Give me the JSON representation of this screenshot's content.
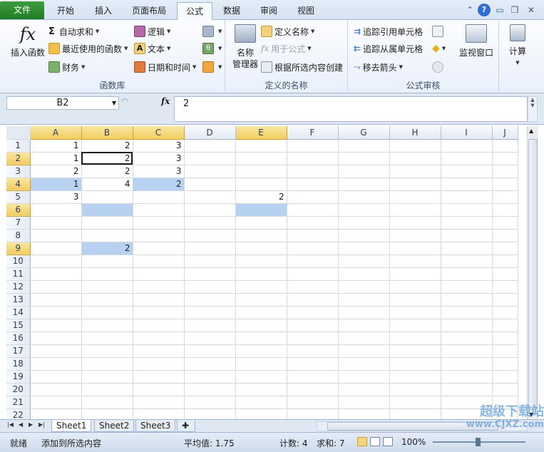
{
  "tabs": [
    "文件",
    "开始",
    "插入",
    "页面布局",
    "公式",
    "数据",
    "审阅",
    "视图"
  ],
  "active_tab": "公式",
  "ribbon": {
    "function_library": {
      "label": "函数库",
      "insert_function": "插入函数",
      "autosum": "自动求和",
      "recent": "最近使用的函数",
      "financial": "财务",
      "logical": "逻辑",
      "text": "文本",
      "datetime": "日期和时间"
    },
    "defined_names": {
      "label": "定义的名称",
      "name_manager_1": "名称",
      "name_manager_2": "管理器",
      "define_name": "定义名称",
      "use_in_formula": "用于公式",
      "create_from_selection": "根据所选内容创建"
    },
    "formula_auditing": {
      "label": "公式审核",
      "trace_precedents": "追踪引用单元格",
      "trace_dependents": "追踪从属单元格",
      "remove_arrows": "移去箭头",
      "watch_window": "监视窗口"
    },
    "calculation": {
      "label": "计算"
    }
  },
  "formula_bar": {
    "name_box": "B2",
    "fx": "fx",
    "value": "2"
  },
  "grid": {
    "columns": [
      "A",
      "B",
      "C",
      "D",
      "E",
      "F",
      "G",
      "H",
      "I",
      "J"
    ],
    "rows": [
      "1",
      "2",
      "3",
      "4",
      "5",
      "6",
      "7",
      "8",
      "9",
      "10",
      "11",
      "12",
      "13",
      "14",
      "15",
      "16",
      "17",
      "18",
      "19",
      "20",
      "21",
      "22"
    ],
    "cells": [
      [
        "1",
        "2",
        "3",
        "",
        "",
        "",
        "",
        "",
        "",
        ""
      ],
      [
        "1",
        "2",
        "3",
        "",
        "",
        "",
        "",
        "",
        "",
        ""
      ],
      [
        "2",
        "2",
        "3",
        "",
        "",
        "",
        "",
        "",
        "",
        ""
      ],
      [
        "1",
        "4",
        "2",
        "",
        "",
        "",
        "",
        "",
        "",
        ""
      ],
      [
        "3",
        "",
        "",
        "",
        "2",
        "",
        "",
        "",
        "",
        ""
      ],
      [
        "",
        "",
        "",
        "",
        "",
        "",
        "",
        "",
        "",
        ""
      ],
      [
        "",
        "",
        "",
        "",
        "",
        "",
        "",
        "",
        "",
        ""
      ],
      [
        "",
        "",
        "",
        "",
        "",
        "",
        "",
        "",
        "",
        ""
      ],
      [
        "",
        "2",
        "",
        "",
        "",
        "",
        "",
        "",
        "",
        ""
      ]
    ]
  },
  "sheets": [
    "Sheet1",
    "Sheet2",
    "Sheet3"
  ],
  "status": {
    "ready": "就绪",
    "mode": "添加到所选内容",
    "average": "平均值: 1.75",
    "count": "计数: 4",
    "sum": "求和: 7",
    "zoom": "100%",
    "watermark_1": "超级下载站",
    "watermark_2": "www.CJXZ.com"
  },
  "colors": {
    "selection_highlight": "#b7d2f0",
    "selected_header": "#f2cc5f",
    "file_tab": "#2b8a2f"
  }
}
